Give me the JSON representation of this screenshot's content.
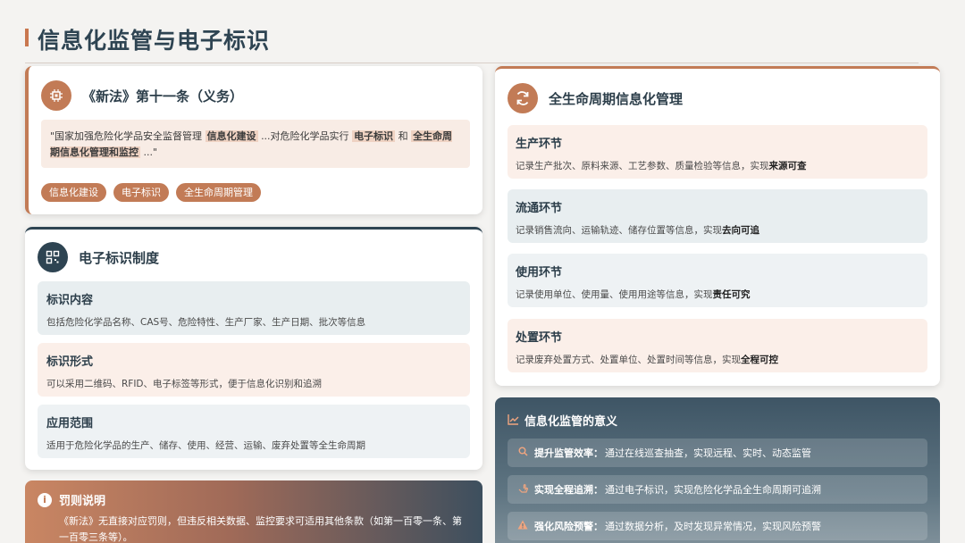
{
  "page": {
    "title": "信息化监管与电子标识"
  },
  "law": {
    "icon": "chip-icon",
    "title": "《新法》第十一条（义务）",
    "quote_prefix": "\"国家加强危险化学品安全监督管理",
    "quote_hl1": "信息化建设",
    "quote_mid1": "...对危险化学品实行",
    "quote_hl2": "电子标识",
    "quote_mid2": "和",
    "quote_hl3": "全生命周期信息化管理和监控",
    "quote_suffix": "...\"",
    "tags": [
      "信息化建设",
      "电子标识",
      "全生命周期管理"
    ]
  },
  "elabel": {
    "icon": "qrcode-icon",
    "title": "电子标识制度",
    "items": [
      {
        "title": "标识内容",
        "desc": "包括危险化学品名称、CAS号、危险特性、生产厂家、生产日期、批次等信息"
      },
      {
        "title": "标识形式",
        "desc": "可以采用二维码、RFID、电子标签等形式，便于信息化识别和追溯"
      },
      {
        "title": "应用范围",
        "desc": "适用于危险化学品的生产、储存、使用、经营、运输、废弃处置等全生命周期"
      }
    ]
  },
  "penalty": {
    "icon": "info-icon",
    "title": "罚则说明",
    "body": "《新法》无直接对应罚则，但违反相关数据、监控要求可适用其他条款（如第一百零一条、第一百零三条等）。"
  },
  "lifecycle": {
    "icon": "refresh-icon",
    "title": "全生命周期信息化管理",
    "stages": [
      {
        "title": "生产环节",
        "desc": "记录生产批次、原料来源、工艺参数、质量检验等信息，实现",
        "bold": "来源可查"
      },
      {
        "title": "流通环节",
        "desc": "记录销售流向、运输轨迹、储存位置等信息，实现",
        "bold": "去向可追"
      },
      {
        "title": "使用环节",
        "desc": "记录使用单位、使用量、使用用途等信息，实现",
        "bold": "责任可究"
      },
      {
        "title": "处置环节",
        "desc": "记录废弃处置方式、处置单位、处置时间等信息，实现",
        "bold": "全程可控"
      }
    ]
  },
  "significance": {
    "icon": "chart-icon",
    "title": "信息化监管的意义",
    "rows": [
      {
        "icon": "search-icon",
        "key": "提升监管效率：",
        "value": "通过在线巡查抽查，实现远程、实时、动态监管"
      },
      {
        "icon": "hand-icon",
        "key": "实现全程追溯：",
        "value": "通过电子标识，实现危险化学品全生命周期可追溯"
      },
      {
        "icon": "warning-icon",
        "key": "强化风险预警：",
        "value": "通过数据分析，及时发现异常情况，实现风险预警"
      }
    ]
  }
}
